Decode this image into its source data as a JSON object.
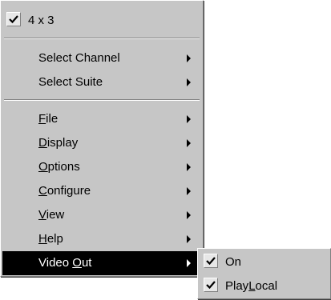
{
  "main_menu": {
    "aspect_item": {
      "label": "4 x 3",
      "checked": true
    },
    "group1": [
      {
        "label": "Select Channel",
        "has_submenu": true
      },
      {
        "label": "Select Suite",
        "has_submenu": true
      }
    ],
    "group2": [
      {
        "label": "File",
        "accel": "F",
        "rest": "ile",
        "has_submenu": true
      },
      {
        "label": "Display",
        "accel": "D",
        "rest": "isplay",
        "has_submenu": true
      },
      {
        "label": "Options",
        "accel": "O",
        "rest": "ptions",
        "has_submenu": true
      },
      {
        "label": "Configure",
        "accel": "C",
        "rest": "onfigure",
        "has_submenu": true
      },
      {
        "label": "View",
        "accel": "V",
        "rest": "iew",
        "has_submenu": true
      },
      {
        "label": "Help",
        "accel": "H",
        "rest": "elp",
        "has_submenu": true
      },
      {
        "label": "Video Out",
        "pre": "Video ",
        "accel": "O",
        "rest": "ut",
        "has_submenu": true,
        "selected": true
      }
    ]
  },
  "sub_menu": {
    "items": [
      {
        "label": "On",
        "checked": true
      },
      {
        "label": "PlayLocal",
        "pre": "Play",
        "accel": "L",
        "rest": "ocal",
        "checked": true
      }
    ]
  },
  "colors": {
    "menu_bg": "#c6c6c6",
    "highlight_bg": "#000000",
    "highlight_fg": "#ffffff",
    "check_box_bg": "#e7e7e7"
  },
  "icons": {
    "check": "checkmark-icon",
    "arrow": "submenu-arrow-icon"
  }
}
